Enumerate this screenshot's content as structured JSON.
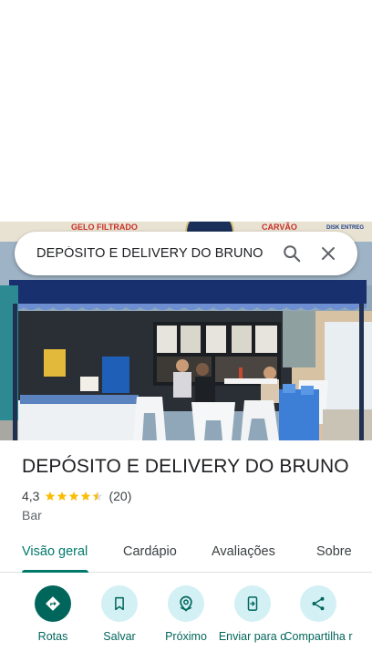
{
  "search": {
    "query": "DEPÓSITO E DELIVERY DO BRUNO"
  },
  "photo": {
    "sign_left": "GELO FILTRADO",
    "sign_right": "CARVÃO",
    "sign_far_right": "DISK ENTREG"
  },
  "place": {
    "name": "DEPÓSITO E DELIVERY DO BRUNO",
    "rating": "4,3",
    "stars": 4.3,
    "reviews": "(20)",
    "category": "Bar"
  },
  "tabs": [
    {
      "label": "Visão geral"
    },
    {
      "label": "Cardápio"
    },
    {
      "label": "Avaliações"
    },
    {
      "label": "Sobre"
    }
  ],
  "actions": [
    {
      "label": "Rotas",
      "icon": "directions-icon"
    },
    {
      "label": "Salvar",
      "icon": "bookmark-icon"
    },
    {
      "label": "Próximo",
      "icon": "nearby-icon"
    },
    {
      "label": "Enviar para o",
      "icon": "send-to-phone-icon"
    },
    {
      "label": "Compartilha r",
      "icon": "share-icon"
    }
  ],
  "colors": {
    "accent": "#00796b",
    "action_primary": "#00665c",
    "action_bg": "#d3f0f4",
    "star": "#fbbc04"
  }
}
